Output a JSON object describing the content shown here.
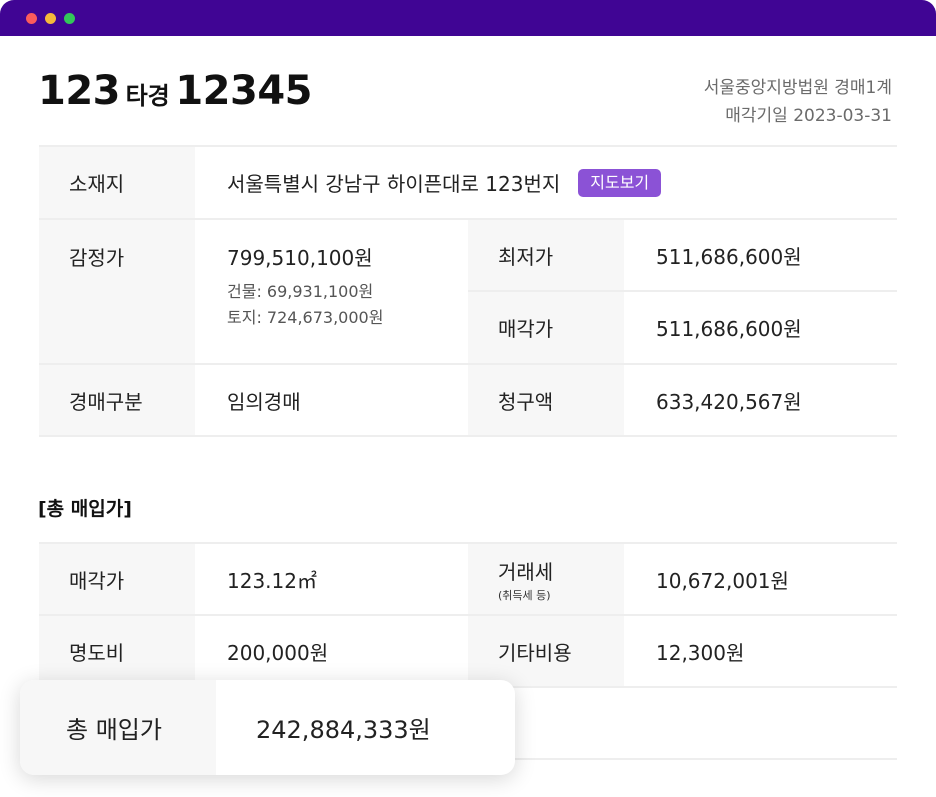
{
  "window": {
    "colors": {
      "titlebar": "#400594",
      "badge": "#8b52d6"
    }
  },
  "case": {
    "court_no": "123",
    "type": "타경",
    "case_no": "12345"
  },
  "court": {
    "name": "서울중앙지방법원 경매1계",
    "sale_date": "매각기일 2023-03-31"
  },
  "info": {
    "address_label": "소재지",
    "address": "서울특별시 강남구 하이픈대로 123번지",
    "map_button": "지도보기",
    "appraisal_label": "감정가",
    "appraisal": "799,510,100원",
    "building": "건물: 69,931,100원",
    "land": "토지: 724,673,000원",
    "min_price_label": "최저가",
    "min_price": "511,686,600원",
    "sale_price_label": "매각가",
    "sale_price": "511,686,600원",
    "auction_type_label": "경매구분",
    "auction_type": "임의경매",
    "claim_label": "청구액",
    "claim": "633,420,567원"
  },
  "total_section": {
    "title": "[총 매입가]",
    "sale_price_label": "매각가",
    "sale_price": "123.12㎡",
    "tax_label": "거래세",
    "tax_sub": "(취득세 등)",
    "tax": "10,672,001원",
    "eviction_label": "명도비",
    "eviction": "200,000원",
    "other_label": "기타비용",
    "other": "12,300원",
    "total_label": "총 매입가",
    "total": "242,884,333원"
  }
}
